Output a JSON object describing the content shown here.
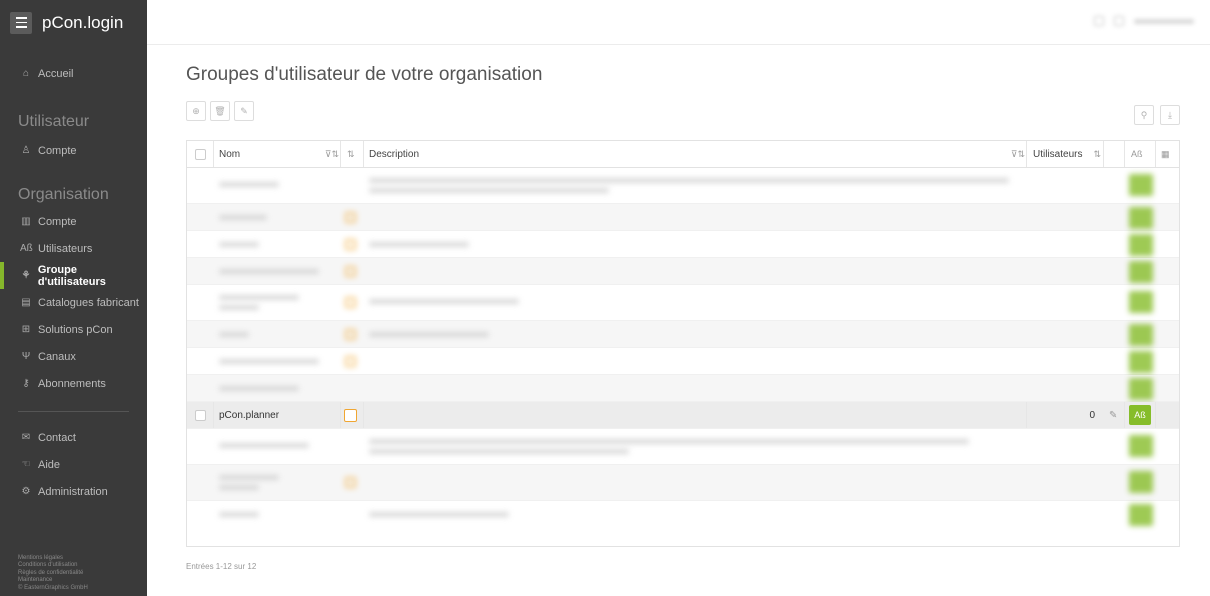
{
  "app": {
    "title": "pCon.login"
  },
  "sidebar": {
    "home": "Accueil",
    "section_user": "Utilisateur",
    "user_account": "Compte",
    "section_org": "Organisation",
    "org_items": [
      {
        "label": "Compte",
        "icon": "building-icon"
      },
      {
        "label": "Utilisateurs",
        "icon": "users-icon"
      },
      {
        "label": "Groupe d'utilisateurs",
        "icon": "group-icon",
        "active": true
      },
      {
        "label": "Catalogues fabricant",
        "icon": "catalog-icon"
      },
      {
        "label": "Solutions pCon",
        "icon": "grid-icon"
      },
      {
        "label": "Canaux",
        "icon": "channel-icon"
      },
      {
        "label": "Abonnements",
        "icon": "key-icon"
      }
    ],
    "bottom_items": [
      {
        "label": "Contact",
        "icon": "mail-icon"
      },
      {
        "label": "Aide",
        "icon": "help-icon"
      },
      {
        "label": "Administration",
        "icon": "gear-icon"
      }
    ],
    "footer": [
      "Mentions légales",
      "Conditions d'utilisation",
      "Règles de confidentialité",
      "Maintenance",
      "© EasternGraphics GmbH"
    ]
  },
  "page": {
    "title": "Groupes d'utilisateur de votre organisation",
    "entries": "Entrées 1-12 sur 12"
  },
  "table": {
    "headers": {
      "name": "Nom",
      "description": "Description",
      "users": "Utilisateurs"
    },
    "visible_row": {
      "name": "pCon.planner",
      "users": "0"
    }
  },
  "colors": {
    "sidebar_bg": "#3a3a3a",
    "accent_green": "#85b62b",
    "orange": "#f0a632"
  }
}
